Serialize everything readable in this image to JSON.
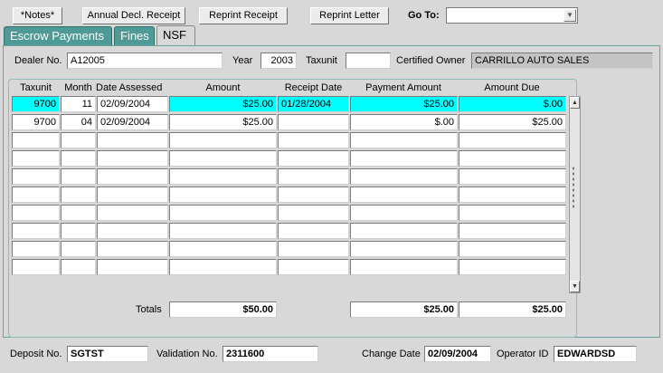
{
  "toolbar": {
    "notes": "*Notes*",
    "annual_decl_receipt": "Annual Decl. Receipt",
    "reprint_receipt": "Reprint Receipt",
    "reprint_letter": "Reprint Letter",
    "goto_label": "Go To:",
    "goto_value": ""
  },
  "tabs": [
    "Escrow Payments",
    "Fines",
    "NSF"
  ],
  "header": {
    "dealer_no_label": "Dealer No.",
    "dealer_no": "A12005",
    "year_label": "Year",
    "year": "2003",
    "taxunit_label": "Taxunit",
    "taxunit": "",
    "certified_owner_label": "Certified Owner",
    "certified_owner": "CARRILLO AUTO SALES"
  },
  "table": {
    "columns": [
      "Taxunit",
      "Month",
      "Date Assessed",
      "Amount",
      "Receipt Date",
      "Payment Amount",
      "Amount Due"
    ],
    "rows": [
      [
        "9700",
        "11",
        "02/09/2004",
        "$25.00",
        "01/28/2004",
        "$25.00",
        "$.00"
      ],
      [
        "9700",
        "04",
        "02/09/2004",
        "$25.00",
        "",
        "$.00",
        "$25.00"
      ],
      [
        "",
        "",
        "",
        "",
        "",
        "",
        ""
      ],
      [
        "",
        "",
        "",
        "",
        "",
        "",
        ""
      ],
      [
        "",
        "",
        "",
        "",
        "",
        "",
        ""
      ],
      [
        "",
        "",
        "",
        "",
        "",
        "",
        ""
      ],
      [
        "",
        "",
        "",
        "",
        "",
        "",
        ""
      ],
      [
        "",
        "",
        "",
        "",
        "",
        "",
        ""
      ],
      [
        "",
        "",
        "",
        "",
        "",
        "",
        ""
      ],
      [
        "",
        "",
        "",
        "",
        "",
        "",
        ""
      ]
    ],
    "selected_row": 0
  },
  "totals": {
    "label": "Totals",
    "amount": "$50.00",
    "payment_amount": "$25.00",
    "amount_due": "$25.00"
  },
  "footer": {
    "deposit_no_label": "Deposit No.",
    "deposit_no": "SGTST",
    "validation_no_label": "Validation No.",
    "validation_no": "2311600",
    "change_date_label": "Change Date",
    "change_date": "02/09/2004",
    "operator_id_label": "Operator ID",
    "operator_id": "EDWARDSD"
  },
  "colors": {
    "tab_bg": "#4f9a96",
    "selected_row": "#00ffff",
    "window_bg": "#d8d8d8"
  }
}
